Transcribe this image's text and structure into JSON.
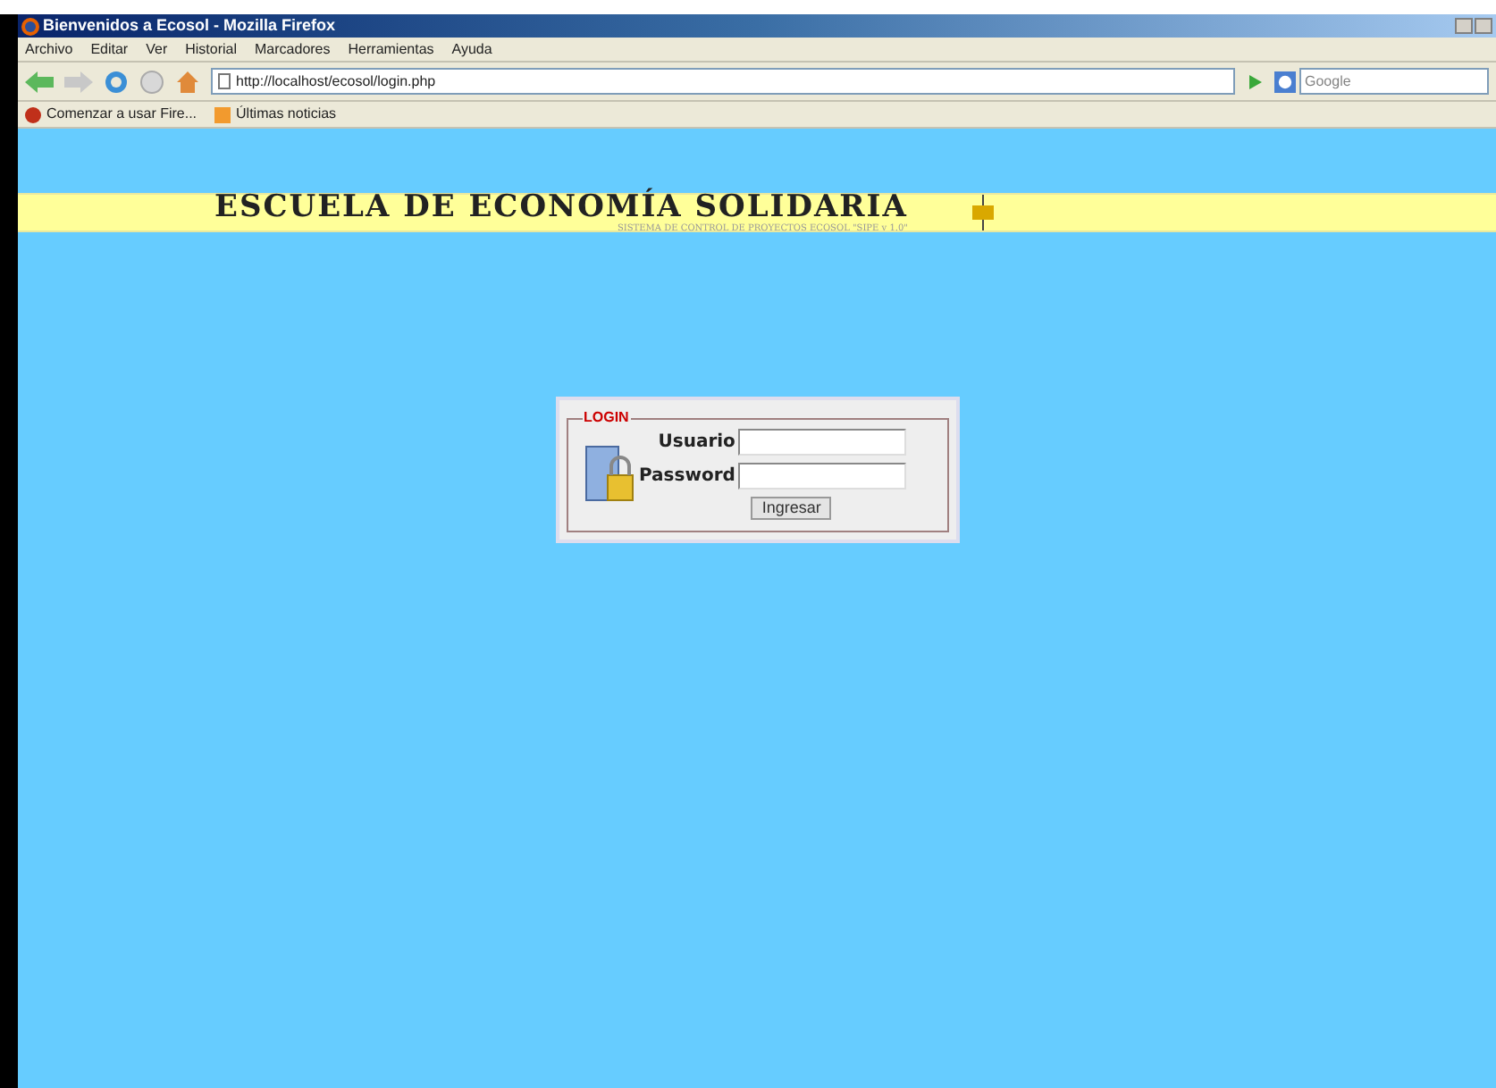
{
  "window": {
    "title": "Bienvenidos a Ecosol - Mozilla Firefox"
  },
  "menu": [
    "Archivo",
    "Editar",
    "Ver",
    "Historial",
    "Marcadores",
    "Herramientas",
    "Ayuda"
  ],
  "address": {
    "value": "http://localhost/ecosol/login.php"
  },
  "search": {
    "placeholder": "Google"
  },
  "bookmarks": [
    {
      "label": "Comenzar a usar Fire...",
      "kind": "start"
    },
    {
      "label": "Últimas noticias",
      "kind": "feed"
    }
  ],
  "banner": {
    "title": "ESCUELA DE ECONOMÍA SOLIDARIA",
    "subtitle": "SISTEMA DE CONTROL DE PROYECTOS ECOSOL \"SIPE v 1.0\""
  },
  "login": {
    "legend": "LOGIN",
    "fields": [
      {
        "label": "Usuario"
      },
      {
        "label": "Password"
      }
    ],
    "button": "Ingresar"
  }
}
